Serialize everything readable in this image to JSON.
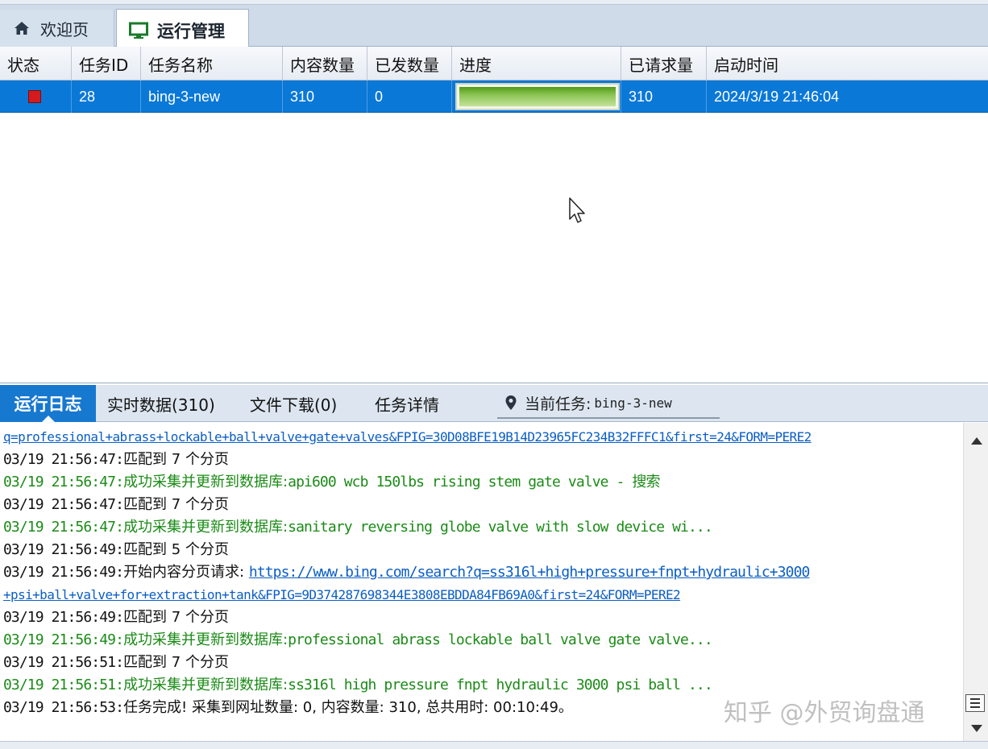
{
  "tabs": {
    "welcome": "欢迎页",
    "run": "运行管理"
  },
  "grid": {
    "columns": [
      "状态",
      "任务ID",
      "任务名称",
      "内容数量",
      "已发数量",
      "进度",
      "已请求量",
      "启动时间"
    ],
    "row": {
      "status_color": "#d41a1a",
      "task_id": "28",
      "task_name": "bing-3-new",
      "content_count": "310",
      "sent_count": "0",
      "progress": 1.0,
      "requested": "310",
      "start_time": "2024/3/19 21:46:04"
    }
  },
  "log_tabs": {
    "run_log": "运行日志",
    "realtime": "实时数据(310)",
    "downloads": "文件下载(0)",
    "details": "任务详情",
    "current_task_label": "当前任务:",
    "current_task_value": "bing-3-new"
  },
  "log": [
    {
      "type": "link",
      "text": "q=professional+abrass+lockable+ball+valve+gate+valves&FPIG=30D08BFE19B14D23965FC234B32FFFC1&first=24&FORM=PERE2"
    },
    {
      "type": "black",
      "time": "03/19 21:56:47:",
      "msg": "匹配到 7 个分页"
    },
    {
      "type": "green",
      "time": "03/19 21:56:47:",
      "msg": "成功采集并更新到数据库:",
      "extra": "api600 wcb 150lbs rising stem gate valve - 搜索"
    },
    {
      "type": "black",
      "time": "03/19 21:56:47:",
      "msg": "匹配到 7 个分页"
    },
    {
      "type": "green",
      "time": "03/19 21:56:47:",
      "msg": "成功采集并更新到数据库:",
      "extra": "sanitary reversing globe valve with slow device wi..."
    },
    {
      "type": "black",
      "time": "03/19 21:56:49:",
      "msg": "匹配到 5 个分页"
    },
    {
      "type": "blacklink",
      "time": "03/19 21:56:49:",
      "msg": "开始内容分页请求: ",
      "link": "https://www.bing.com/search?q=ss316l+high+pressure+fnpt+hydraulic+3000"
    },
    {
      "type": "link",
      "text": "+psi+ball+valve+for+extraction+tank&FPIG=9D374287698344E3808EBDDA84FB69A0&first=24&FORM=PERE2"
    },
    {
      "type": "black",
      "time": "03/19 21:56:49:",
      "msg": "匹配到 7 个分页"
    },
    {
      "type": "green",
      "time": "03/19 21:56:49:",
      "msg": "成功采集并更新到数据库:",
      "extra": "professional abrass lockable ball valve gate valve..."
    },
    {
      "type": "black",
      "time": "03/19 21:56:51:",
      "msg": "匹配到 7 个分页"
    },
    {
      "type": "green",
      "time": "03/19 21:56:51:",
      "msg": "成功采集并更新到数据库:",
      "extra": "ss316l high pressure fnpt hydraulic 3000 psi ball ..."
    },
    {
      "type": "black",
      "time": "03/19 21:56:53:",
      "msg": "任务完成! 采集到网址数量: 0, 内容数量: 310, 总共用时: 00:10:49。"
    }
  ],
  "watermark": "知乎 @外贸询盘通",
  "colors": {
    "selection": "#0a78d7",
    "active_log_tab": "#1778d0",
    "log_green": "#1b8b17",
    "link_blue": "#0b5ec4"
  }
}
